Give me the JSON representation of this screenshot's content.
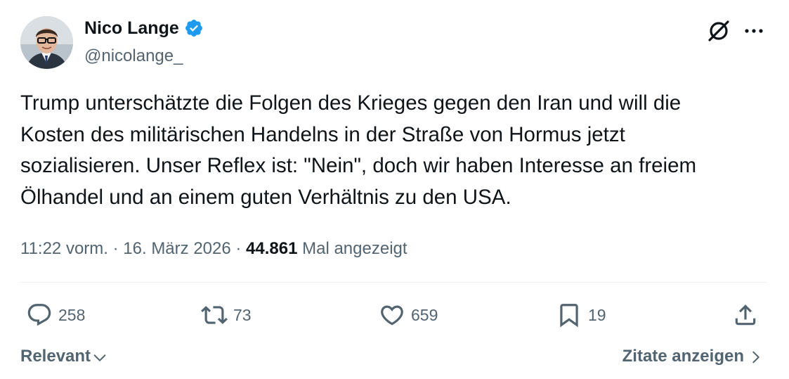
{
  "author": {
    "name": "Nico Lange",
    "handle": "@nicolange_",
    "verified": true
  },
  "tweet": {
    "text": "Trump unterschätzte die Folgen des Krieges gegen den Iran und will die\nKosten des militärischen Handelns in der Straße von Hormus jetzt\nsozialisieren. Unser Reflex ist: \"Nein\", doch wir haben Interesse an freiem\nÖlhandel und an einem guten Verhältnis zu den USA."
  },
  "meta": {
    "time": "11:22 vorm.",
    "separator": " · ",
    "date": "16. März 2026",
    "views_count": "44.861",
    "views_label": "Mal angezeigt"
  },
  "actions": {
    "replies": "258",
    "reposts": "73",
    "likes": "659",
    "bookmarks": "19"
  },
  "footer": {
    "sort_label": "Relevant",
    "quotes_label": "Zitate anzeigen"
  },
  "icons": {
    "grok": "grok-icon",
    "more": "more-icon",
    "reply": "reply-icon",
    "repost": "repost-icon",
    "like": "like-icon",
    "bookmark": "bookmark-icon",
    "share": "share-icon",
    "verified": "verified-badge-icon"
  },
  "colors": {
    "text": "#0f1419",
    "secondary": "#536471",
    "verified_blue": "#1d9bf0",
    "divider": "#eff3f4"
  }
}
